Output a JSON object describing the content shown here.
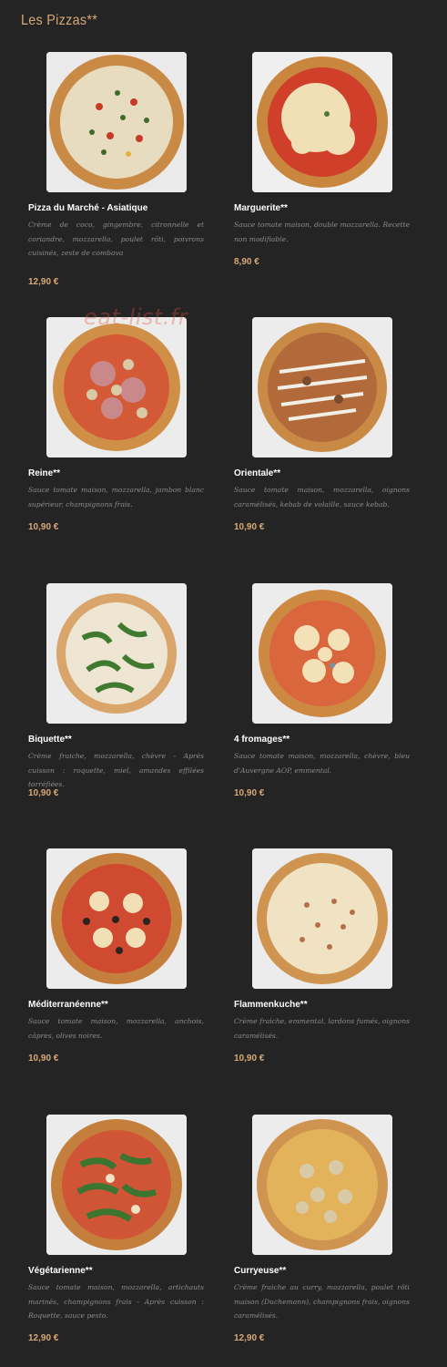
{
  "section": {
    "title": "Les Pizzas**"
  },
  "watermark": "eat-list.fr",
  "pizzas": [
    {
      "name": "Pizza du Marché - Asiatique",
      "description": "Crème de coco, gingembre, citronnelle et coriandre, mozzarella, poulet rôti, poivrons cuisinés, zeste de combava",
      "price": "12,90 €",
      "photo": "pizza-asiatique-photo"
    },
    {
      "name": "Marguerite**",
      "description": "Sauce tomate maison, double mozzarella. Recette non modifiable.",
      "price": "8,90 €",
      "photo": "pizza-marguerite-photo"
    },
    {
      "name": "Reine**",
      "description": "Sauce tomate maison, mozzarella, jambon blanc supérieur, champignons frais.",
      "price": "10,90 €",
      "photo": "pizza-reine-photo"
    },
    {
      "name": "Orientale**",
      "description": "Sauce tomate maison, mozzarella, oignons caramélisés, kebab de volaille, sauce kebab.",
      "price": "10,90 €",
      "photo": "pizza-orientale-photo"
    },
    {
      "name": "Biquette**",
      "description": "Crème fraiche, mozzarella, chèvre - Après cuisson : roquette, miel, amandes effilées torréfiées.",
      "price": "10,90 €",
      "photo": "pizza-biquette-photo"
    },
    {
      "name": "4 fromages**",
      "description": "Sauce tomate maison, mozzarella, chèvre, bleu d'Auvergne AOP, emmental.",
      "price": "10,90 €",
      "photo": "pizza-4-fromages-photo"
    },
    {
      "name": "Méditerranéenne**",
      "description": "Sauce tomate maison, mozzarella, anchois, câpres, olives noires.",
      "price": "10,90 €",
      "photo": "pizza-mediterraneenne-photo"
    },
    {
      "name": "Flammenkuche**",
      "description": "Crème fraiche, emmental, lardons fumés, oignons caramélisés.",
      "price": "10,90 €",
      "photo": "pizza-flammenkuche-photo"
    },
    {
      "name": "Végétarienne**",
      "description": "Sauce tomate maison, mozzarella, artichauts marinés, champignons frais - Après cuisson : Roquette, sauce pesto.",
      "price": "12,90 €",
      "photo": "pizza-vegetarienne-photo"
    },
    {
      "name": "Curryeuse**",
      "description": "Crème fraiche au curry, mozzarella, poulet rôti maison (Duchemann), champignons frais, oignons caramélisés.",
      "price": "12,90 €",
      "photo": "pizza-curryeuse-photo"
    }
  ]
}
